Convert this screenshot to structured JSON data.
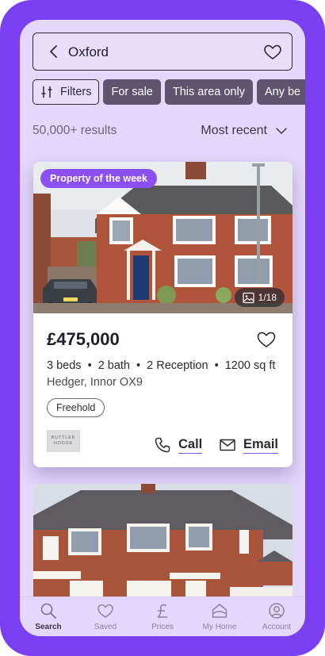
{
  "search": {
    "query": "Oxford"
  },
  "filters": [
    "Filters",
    "For sale",
    "This area only",
    "Any be"
  ],
  "results": {
    "count": "50,000+ results",
    "sort": "Most recent"
  },
  "listing": {
    "badge": "Property of the week",
    "photo_count": "1/18",
    "price": "£475,000",
    "beds": "3 beds",
    "baths": "2 bath",
    "reception": "2 Reception",
    "area": "1200 sq ft",
    "address": "Hedger, Innor OX9",
    "tenure": "Freehold",
    "agent_logo": [
      "BUTTLER",
      "HODGE"
    ],
    "call_label": "Call",
    "email_label": "Email",
    "separator": "•"
  },
  "nav": [
    {
      "label": "Search",
      "icon": "search-icon",
      "active": true
    },
    {
      "label": "Saved",
      "icon": "heart-icon",
      "active": false
    },
    {
      "label": "Prices",
      "icon": "pound-icon",
      "active": false
    },
    {
      "label": "My Home",
      "icon": "home-icon",
      "active": false
    },
    {
      "label": "Account",
      "icon": "account-icon",
      "active": false
    }
  ],
  "colors": {
    "frame": "#7a3ff0",
    "screen": "#e3d7fb",
    "accent": "#8b4ff2",
    "chip": "#5f5470"
  }
}
